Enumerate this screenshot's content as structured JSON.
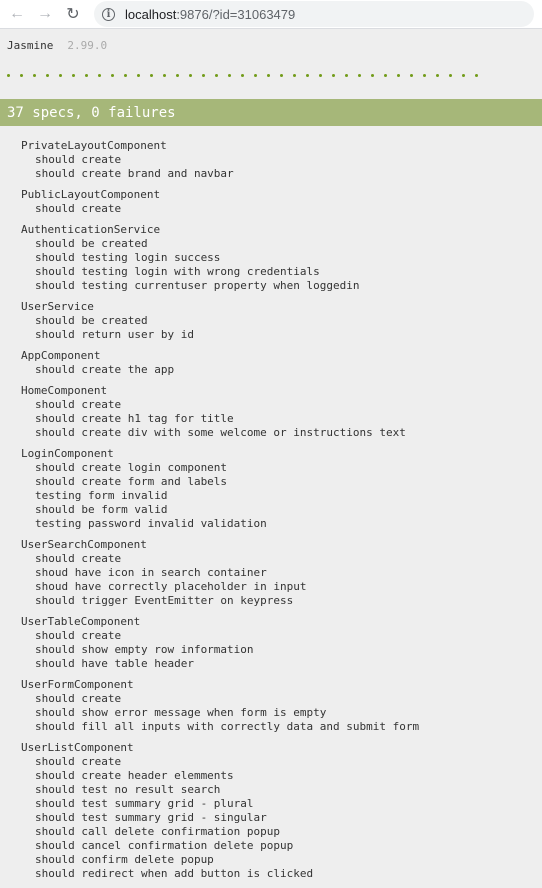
{
  "browser": {
    "url_host": "localhost",
    "url_rest": ":9876/?id=31063479",
    "icons": {
      "back": "arrow-left-icon",
      "forward": "arrow-right-icon",
      "reload": "reload-icon",
      "info": "info-icon"
    }
  },
  "jasmine": {
    "title": "Jasmine",
    "version": "2.99.0",
    "summary": "37 specs, 0 failures",
    "dot_count": 37,
    "colors": {
      "pass": "#739c1b",
      "summary_bar": "#a6b779"
    }
  },
  "suites": [
    {
      "title": "PrivateLayoutComponent",
      "specs": [
        "should create",
        "should create brand and navbar"
      ]
    },
    {
      "title": "PublicLayoutComponent",
      "specs": [
        "should create"
      ]
    },
    {
      "title": "AuthenticationService",
      "specs": [
        "should be created",
        "should testing login success",
        "should testing login with wrong credentials",
        "should testing currentuser property when loggedin"
      ]
    },
    {
      "title": "UserService",
      "specs": [
        "should be created",
        "should return user by id"
      ]
    },
    {
      "title": "AppComponent",
      "specs": [
        "should create the app"
      ]
    },
    {
      "title": "HomeComponent",
      "specs": [
        "should create",
        "should create h1 tag for title",
        "should create div with some welcome or instructions text"
      ]
    },
    {
      "title": "LoginComponent",
      "specs": [
        "should create login component",
        "should create form and labels",
        "testing form invalid",
        "should be form valid",
        "testing password invalid validation"
      ]
    },
    {
      "title": "UserSearchComponent",
      "specs": [
        "should create",
        "shoud have icon in search container",
        "shoud have correctly placeholder in input",
        "should trigger EventEmitter on keypress"
      ]
    },
    {
      "title": "UserTableComponent",
      "specs": [
        "should create",
        "should show empty row information",
        "should have table header"
      ]
    },
    {
      "title": "UserFormComponent",
      "specs": [
        "should create",
        "should show error message when form is empty",
        "should fill all inputs with correctly data and submit form"
      ]
    },
    {
      "title": "UserListComponent",
      "specs": [
        "should create",
        "should create header elemments",
        "should test no result search",
        "should test summary grid - plural",
        "should test summary grid - singular",
        "should call delete confirmation popup",
        "should cancel confirmation delete popup",
        "should confirm delete popup",
        "should redirect when add button is clicked"
      ]
    }
  ]
}
